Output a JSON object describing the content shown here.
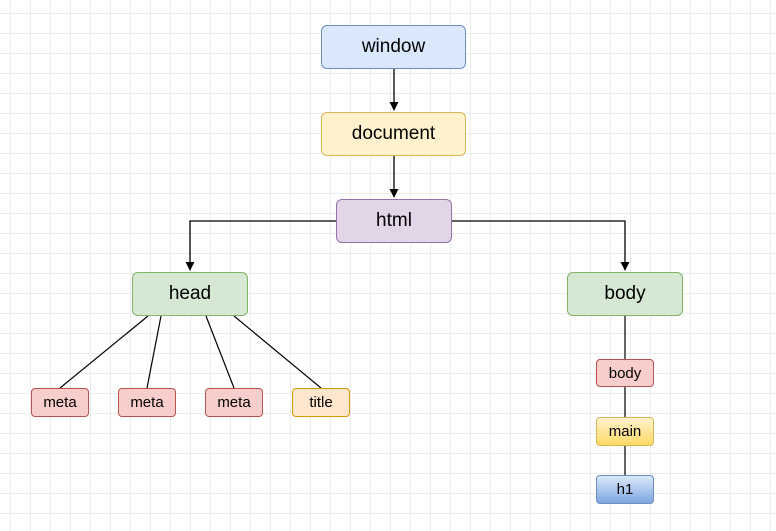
{
  "nodes": {
    "window": "window",
    "document": "document",
    "html": "html",
    "head": "head",
    "body": "body",
    "meta1": "meta",
    "meta2": "meta",
    "meta3": "meta",
    "title": "title",
    "body_child": "body",
    "main": "main",
    "h1": "h1"
  },
  "colors": {
    "window": "#dae8fc",
    "document": "#fff2cc",
    "html": "#e1d5e7",
    "head": "#d5e8d4",
    "body": "#d5e8d4",
    "meta": "#f8cecc",
    "title": "#ffe6cc",
    "main": "#ffd966",
    "h1": "#7ea6e0"
  }
}
